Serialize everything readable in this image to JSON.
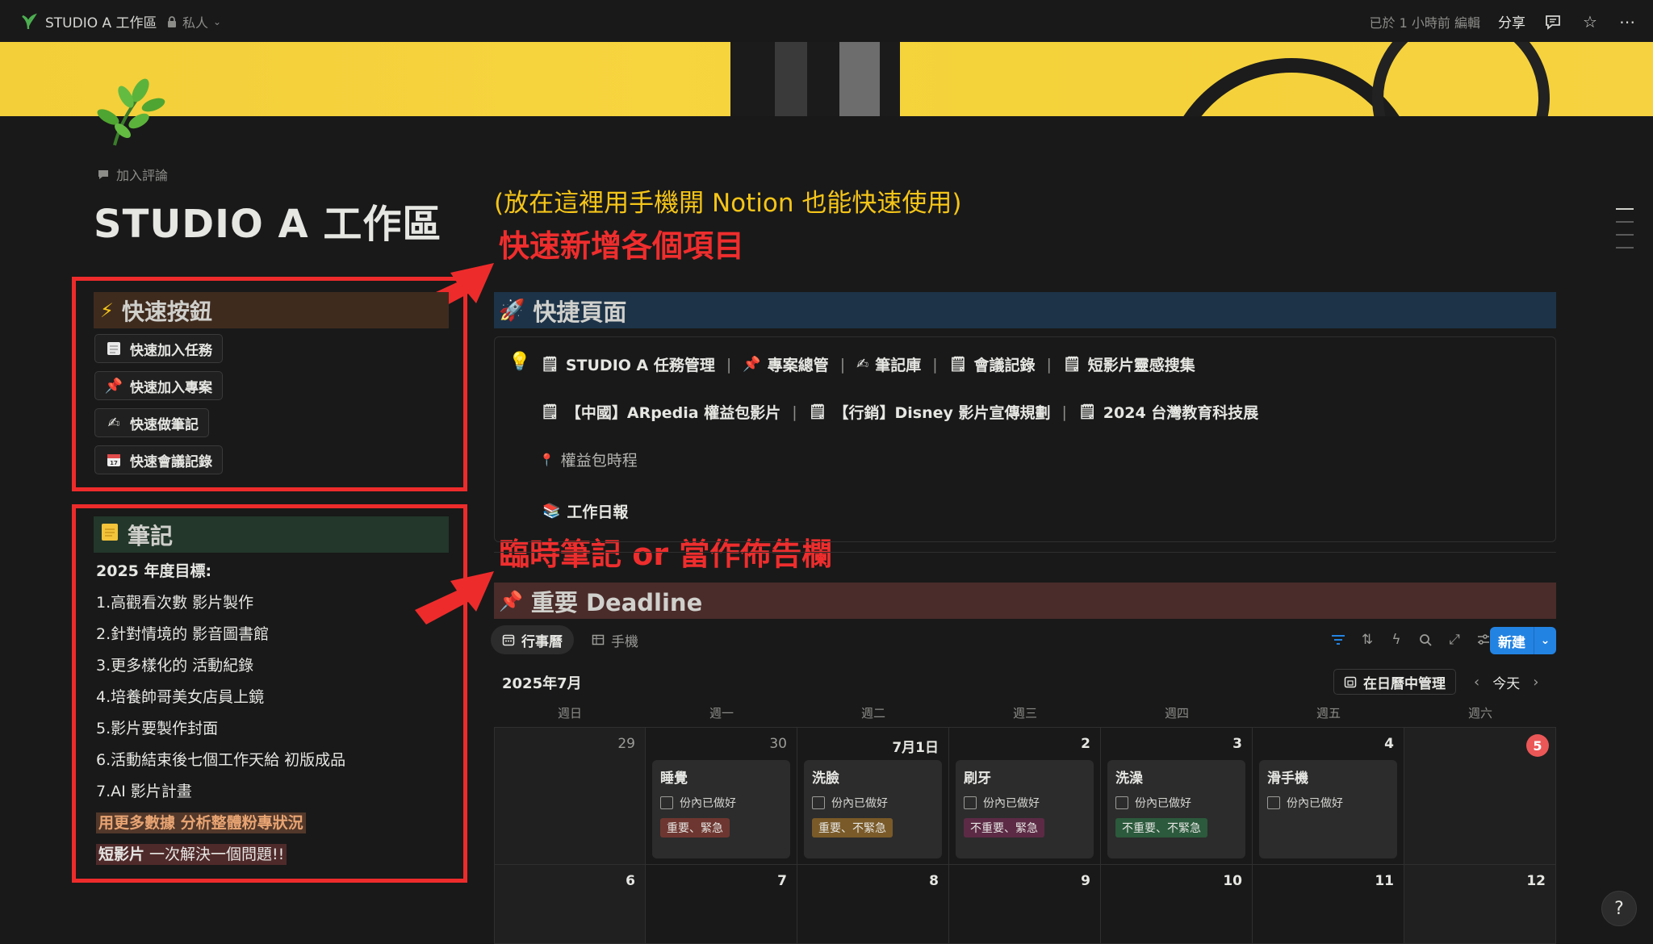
{
  "topbar": {
    "title": "STUDIO A 工作區",
    "privacy": "私人",
    "edited": "已於 1 小時前 編輯",
    "share": "分享",
    "icons": [
      "comment-icon",
      "star-icon",
      "more-icon"
    ]
  },
  "page": {
    "add_comment": "加入評論",
    "title": "STUDIO A 工作區"
  },
  "annotations": {
    "mobile_hint": "(放在這裡用手機開 Notion 也能快速使用)",
    "quick_add": "快速新增各個項目",
    "notes_board": "臨時筆記 or 當作佈告欄"
  },
  "quick_buttons": {
    "header": "快速按鈕",
    "items": [
      {
        "label": "快速加入任務",
        "icon": "note-icon"
      },
      {
        "label": "快速加入專案",
        "icon": "pin-icon"
      },
      {
        "label": "快速做筆記",
        "icon": "writing-hand-icon"
      },
      {
        "label": "快速會議記錄",
        "icon": "calendar-icon"
      }
    ]
  },
  "notes": {
    "header": "筆記",
    "heading": "2025 年度目標:",
    "lines": [
      "1.高觀看次數 影片製作",
      "2.針對情境的 影音圖書館",
      "3.更多樣化的 活動紀錄",
      "4.培養帥哥美女店員上鏡",
      "5.影片要製作封面",
      "6.活動結束後七個工作天給 初版成品",
      "7.AI 影片計畫"
    ],
    "highlight_orange": "用更多數據 分析整體粉專狀況",
    "highlight_red_bold": "短影片",
    "highlight_red_rest": " 一次解決一個問題!!"
  },
  "shortcuts": {
    "header": "快捷頁面",
    "row1": [
      "STUDIO A 任務管理",
      "專案總管",
      "筆記庫",
      "會議記錄",
      "短影片靈感搜集"
    ],
    "row2": [
      "【中國】ARpedia 權益包影片",
      "【行銷】Disney 影片宣傳規劃",
      "2024 台灣教育科技展"
    ],
    "row3": "權益包時程",
    "row4": "工作日報"
  },
  "deadline": {
    "header": "重要 Deadline",
    "tabs": [
      "行事曆",
      "手機"
    ],
    "new_label": "新建",
    "month": "2025年7月",
    "manage_label": "在日曆中管理",
    "today_label": "今天",
    "weekdays": [
      "週日",
      "週一",
      "週二",
      "週三",
      "週四",
      "週五",
      "週六"
    ],
    "week1": [
      "29",
      "30",
      "7月1日",
      "2",
      "3",
      "4",
      "5"
    ],
    "week2": [
      "6",
      "7",
      "8",
      "9",
      "10",
      "11",
      "12"
    ],
    "events": [
      {
        "title": "睡覺",
        "check": "份內已做好",
        "tag": "重要、緊急"
      },
      {
        "title": "洗臉",
        "check": "份內已做好",
        "tag": "重要、不緊急"
      },
      {
        "title": "刷牙",
        "check": "份內已做好",
        "tag": "不重要、緊急"
      },
      {
        "title": "洗澡",
        "check": "份內已做好",
        "tag": "不重要、不緊急"
      },
      {
        "title": "滑手機",
        "check": "份內已做好",
        "tag": ""
      }
    ]
  },
  "colors": {
    "accent": "#2383e2",
    "annotation_red": "#ef2d2d",
    "annotation_yellow": "#f5c518",
    "today": "#eb5757"
  }
}
